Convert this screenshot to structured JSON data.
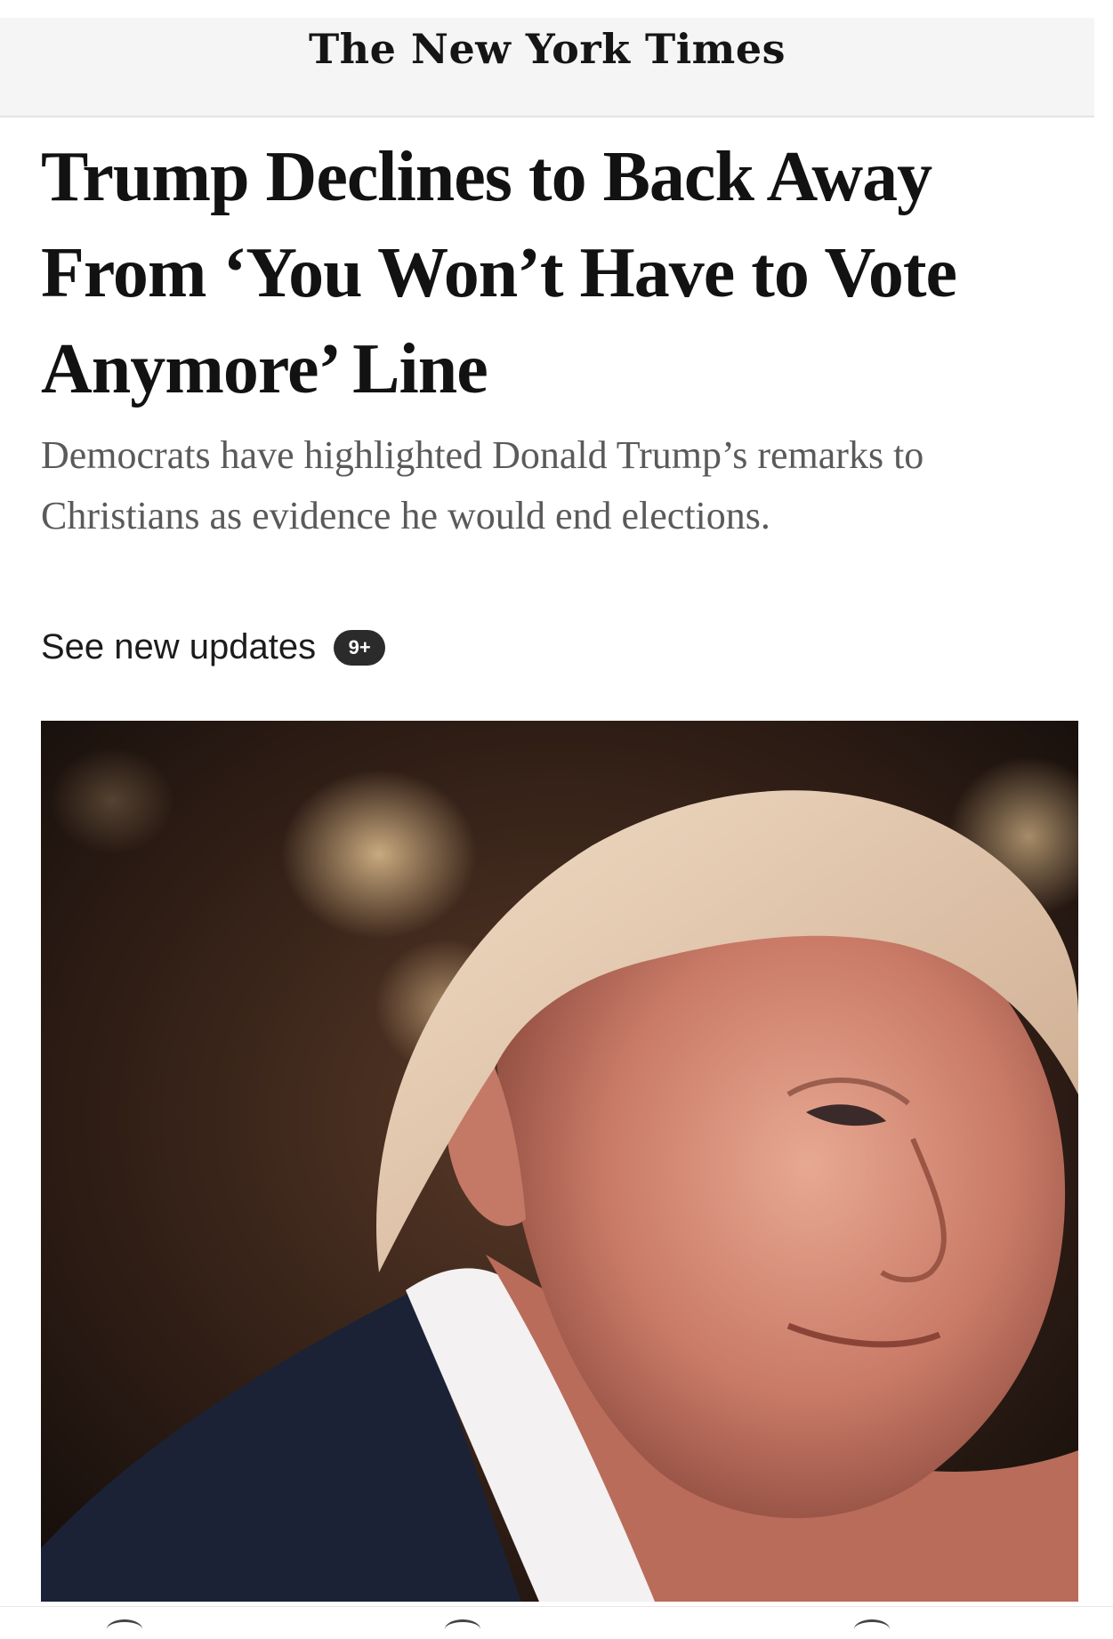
{
  "masthead": {
    "logo_text": "The New York Times"
  },
  "article": {
    "headline": "Trump Declines to Back Away From ‘You Won’t Have to Vote Anymore’ Line",
    "summary": "Democrats have highlighted Donald Trump’s remarks to Christians as evidence he would end elections.",
    "updates_label": "See new updates",
    "updates_badge": "9+"
  },
  "colors": {
    "headline": "#121212",
    "summary": "#5a5a5a",
    "badge_bg": "#2b2b2b",
    "masthead_bg": "#f5f5f5"
  },
  "icons": [
    "bottom-nav-icon",
    "bottom-nav-icon",
    "bottom-nav-icon"
  ]
}
